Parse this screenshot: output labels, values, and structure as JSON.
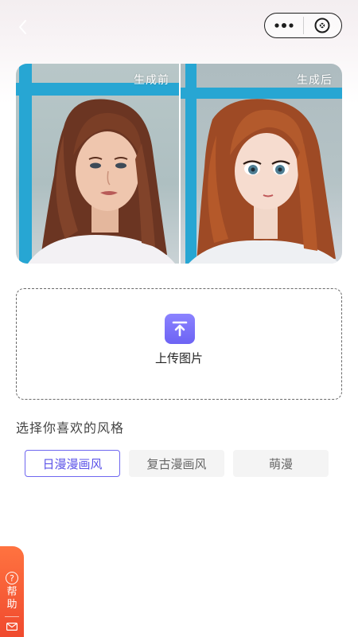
{
  "header": {
    "back_icon": "chevron-left-icon",
    "more_icon": "more-dots-icon",
    "close_icon": "close-circle-icon"
  },
  "compare": {
    "before_label": "生成前",
    "after_label": "生成后"
  },
  "upload": {
    "icon": "upload-arrow-icon",
    "label": "上传图片",
    "accent": "#6d63f4"
  },
  "style_section": {
    "title": "选择你喜欢的风格",
    "options": [
      {
        "label": "日漫漫画风",
        "selected": true
      },
      {
        "label": "复古漫画风",
        "selected": false
      },
      {
        "label": "萌漫",
        "selected": false
      }
    ],
    "active_color": "#5b53e8"
  },
  "help": {
    "label": "帮助",
    "icon": "question-icon",
    "mail_icon": "mail-icon",
    "color": "#f04a2e"
  }
}
